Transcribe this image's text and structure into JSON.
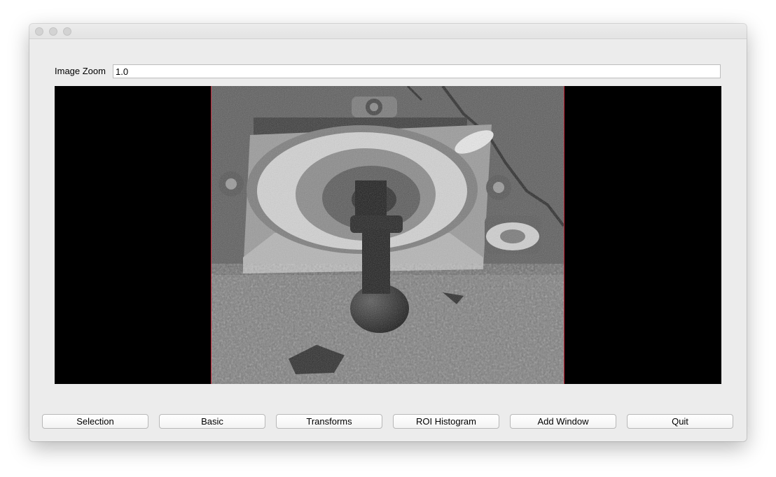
{
  "window": {
    "title": ""
  },
  "zoom": {
    "label": "Image Zoom",
    "value": "1.0"
  },
  "viewer": {
    "image_kind": "grayscale rover calibration target photo",
    "frame_color": "#c62a3c"
  },
  "buttons": {
    "selection": "Selection",
    "basic": "Basic",
    "transforms": "Transforms",
    "roi_histogram": "ROI Histogram",
    "add_window": "Add Window",
    "quit": "Quit"
  }
}
